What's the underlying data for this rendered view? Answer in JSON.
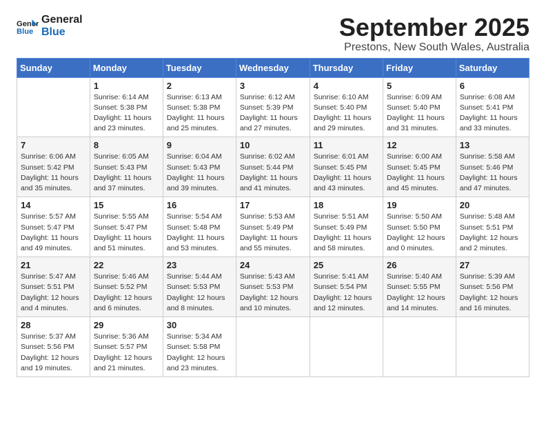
{
  "header": {
    "logo_line1": "General",
    "logo_line2": "Blue",
    "month_title": "September 2025",
    "location": "Prestons, New South Wales, Australia"
  },
  "days_of_week": [
    "Sunday",
    "Monday",
    "Tuesday",
    "Wednesday",
    "Thursday",
    "Friday",
    "Saturday"
  ],
  "weeks": [
    [
      {
        "day": "",
        "info": ""
      },
      {
        "day": "1",
        "info": "Sunrise: 6:14 AM\nSunset: 5:38 PM\nDaylight: 11 hours\nand 23 minutes."
      },
      {
        "day": "2",
        "info": "Sunrise: 6:13 AM\nSunset: 5:38 PM\nDaylight: 11 hours\nand 25 minutes."
      },
      {
        "day": "3",
        "info": "Sunrise: 6:12 AM\nSunset: 5:39 PM\nDaylight: 11 hours\nand 27 minutes."
      },
      {
        "day": "4",
        "info": "Sunrise: 6:10 AM\nSunset: 5:40 PM\nDaylight: 11 hours\nand 29 minutes."
      },
      {
        "day": "5",
        "info": "Sunrise: 6:09 AM\nSunset: 5:40 PM\nDaylight: 11 hours\nand 31 minutes."
      },
      {
        "day": "6",
        "info": "Sunrise: 6:08 AM\nSunset: 5:41 PM\nDaylight: 11 hours\nand 33 minutes."
      }
    ],
    [
      {
        "day": "7",
        "info": "Sunrise: 6:06 AM\nSunset: 5:42 PM\nDaylight: 11 hours\nand 35 minutes."
      },
      {
        "day": "8",
        "info": "Sunrise: 6:05 AM\nSunset: 5:43 PM\nDaylight: 11 hours\nand 37 minutes."
      },
      {
        "day": "9",
        "info": "Sunrise: 6:04 AM\nSunset: 5:43 PM\nDaylight: 11 hours\nand 39 minutes."
      },
      {
        "day": "10",
        "info": "Sunrise: 6:02 AM\nSunset: 5:44 PM\nDaylight: 11 hours\nand 41 minutes."
      },
      {
        "day": "11",
        "info": "Sunrise: 6:01 AM\nSunset: 5:45 PM\nDaylight: 11 hours\nand 43 minutes."
      },
      {
        "day": "12",
        "info": "Sunrise: 6:00 AM\nSunset: 5:45 PM\nDaylight: 11 hours\nand 45 minutes."
      },
      {
        "day": "13",
        "info": "Sunrise: 5:58 AM\nSunset: 5:46 PM\nDaylight: 11 hours\nand 47 minutes."
      }
    ],
    [
      {
        "day": "14",
        "info": "Sunrise: 5:57 AM\nSunset: 5:47 PM\nDaylight: 11 hours\nand 49 minutes."
      },
      {
        "day": "15",
        "info": "Sunrise: 5:55 AM\nSunset: 5:47 PM\nDaylight: 11 hours\nand 51 minutes."
      },
      {
        "day": "16",
        "info": "Sunrise: 5:54 AM\nSunset: 5:48 PM\nDaylight: 11 hours\nand 53 minutes."
      },
      {
        "day": "17",
        "info": "Sunrise: 5:53 AM\nSunset: 5:49 PM\nDaylight: 11 hours\nand 55 minutes."
      },
      {
        "day": "18",
        "info": "Sunrise: 5:51 AM\nSunset: 5:49 PM\nDaylight: 11 hours\nand 58 minutes."
      },
      {
        "day": "19",
        "info": "Sunrise: 5:50 AM\nSunset: 5:50 PM\nDaylight: 12 hours\nand 0 minutes."
      },
      {
        "day": "20",
        "info": "Sunrise: 5:48 AM\nSunset: 5:51 PM\nDaylight: 12 hours\nand 2 minutes."
      }
    ],
    [
      {
        "day": "21",
        "info": "Sunrise: 5:47 AM\nSunset: 5:51 PM\nDaylight: 12 hours\nand 4 minutes."
      },
      {
        "day": "22",
        "info": "Sunrise: 5:46 AM\nSunset: 5:52 PM\nDaylight: 12 hours\nand 6 minutes."
      },
      {
        "day": "23",
        "info": "Sunrise: 5:44 AM\nSunset: 5:53 PM\nDaylight: 12 hours\nand 8 minutes."
      },
      {
        "day": "24",
        "info": "Sunrise: 5:43 AM\nSunset: 5:53 PM\nDaylight: 12 hours\nand 10 minutes."
      },
      {
        "day": "25",
        "info": "Sunrise: 5:41 AM\nSunset: 5:54 PM\nDaylight: 12 hours\nand 12 minutes."
      },
      {
        "day": "26",
        "info": "Sunrise: 5:40 AM\nSunset: 5:55 PM\nDaylight: 12 hours\nand 14 minutes."
      },
      {
        "day": "27",
        "info": "Sunrise: 5:39 AM\nSunset: 5:56 PM\nDaylight: 12 hours\nand 16 minutes."
      }
    ],
    [
      {
        "day": "28",
        "info": "Sunrise: 5:37 AM\nSunset: 5:56 PM\nDaylight: 12 hours\nand 19 minutes."
      },
      {
        "day": "29",
        "info": "Sunrise: 5:36 AM\nSunset: 5:57 PM\nDaylight: 12 hours\nand 21 minutes."
      },
      {
        "day": "30",
        "info": "Sunrise: 5:34 AM\nSunset: 5:58 PM\nDaylight: 12 hours\nand 23 minutes."
      },
      {
        "day": "",
        "info": ""
      },
      {
        "day": "",
        "info": ""
      },
      {
        "day": "",
        "info": ""
      },
      {
        "day": "",
        "info": ""
      }
    ]
  ]
}
